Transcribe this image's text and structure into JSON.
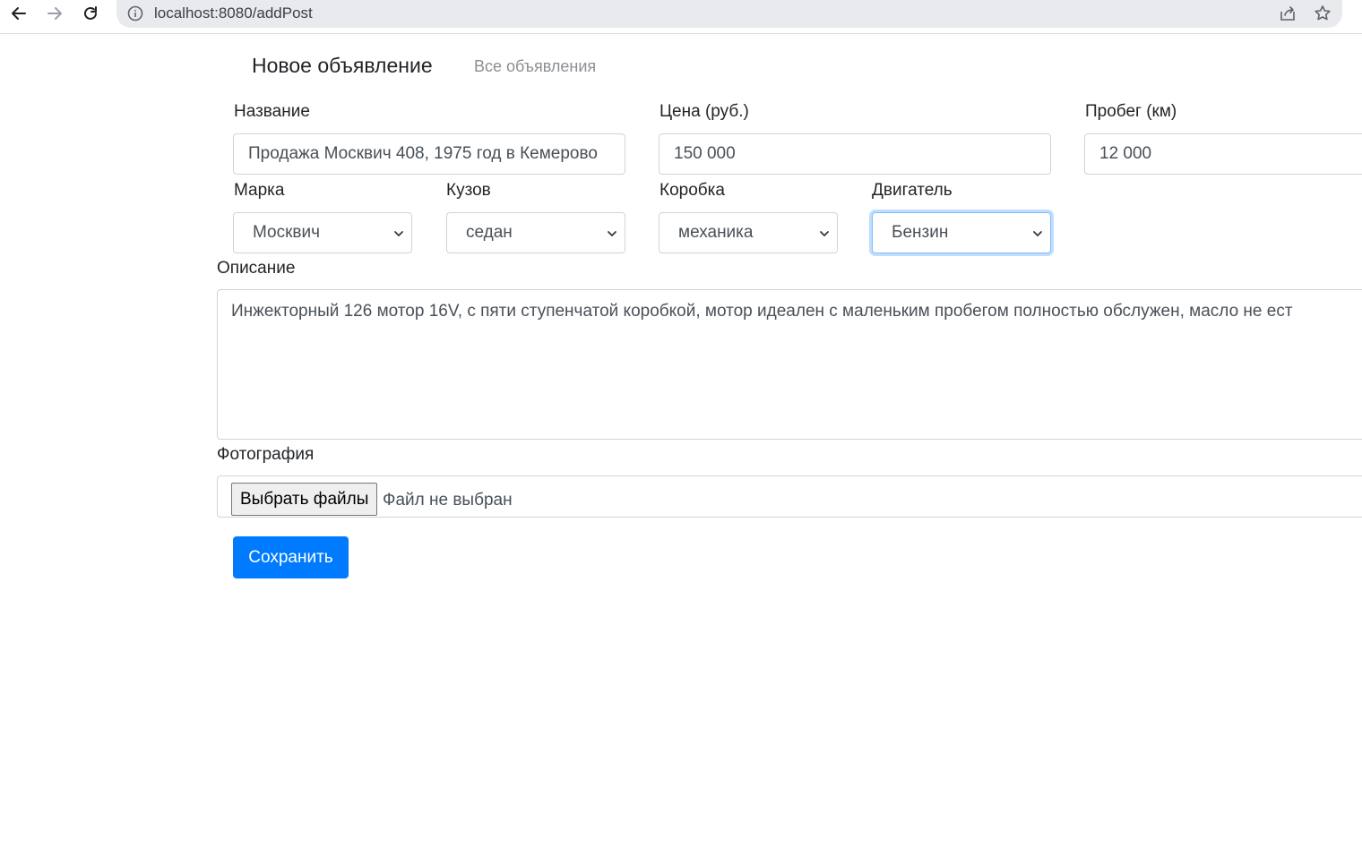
{
  "browser": {
    "url_host": "localhost",
    "url_port": ":8080",
    "url_path": "/addPost"
  },
  "nav": {
    "title": "Новое объявление",
    "all_posts_link": "Все объявления"
  },
  "form": {
    "name_label": "Название",
    "name_value": "Продажа Москвич 408, 1975 год в Кемерово",
    "price_label": "Цена (руб.)",
    "price_value": "150 000",
    "mileage_label": "Пробег (км)",
    "mileage_value": "12 000",
    "brand_label": "Марка",
    "brand_value": "Москвич",
    "body_label": "Кузов",
    "body_value": "седан",
    "gearbox_label": "Коробка",
    "gearbox_value": "механика",
    "engine_label": "Двигатель",
    "engine_value": "Бензин",
    "description_label": "Описание",
    "description_value": "Инжекторный 126 мотор 16V, с пяти ступенчатой коробкой, мотор идеален с маленьким пробегом полностью обслужен, масло не ест",
    "photo_label": "Фотография",
    "file_button_label": "Выбрать файлы",
    "file_status": "Файл не выбран",
    "save_label": "Сохранить"
  },
  "colors": {
    "primary": "#007bff",
    "focus_border": "#80bdff",
    "muted_link": "#8a8f94"
  }
}
